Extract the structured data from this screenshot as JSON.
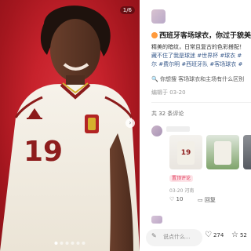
{
  "photo": {
    "counter": "1/6",
    "dots_total": 6,
    "active_dot": 1
  },
  "post": {
    "title": "西班牙客场球衣，你过于貌美了",
    "body_lines": [
      "精美的暗纹，日常且复古的色彩搭配！",
      "藏不住了我是球迷 #世界杯 #球衣 #",
      "尔 #费尔明 #西班牙队 #客场球衣 #"
    ],
    "search_prefix": "你想搜",
    "search_text": "客场球衣和主场有什么区别",
    "date": "编辑于 03-20",
    "comments_total": "共 32 条评论"
  },
  "comment": {
    "badge": "置顶评论",
    "time": "03-20 河南",
    "likes": "10",
    "reply": "回复",
    "thumb_number": "19"
  },
  "bottom_bar": {
    "input_placeholder": "说点什么...",
    "likes": "274",
    "collects": "52"
  },
  "colors": {
    "brand_red": "#c7222c",
    "tag_blue": "#3a5b8c",
    "accent_pink": "#e0395a"
  }
}
